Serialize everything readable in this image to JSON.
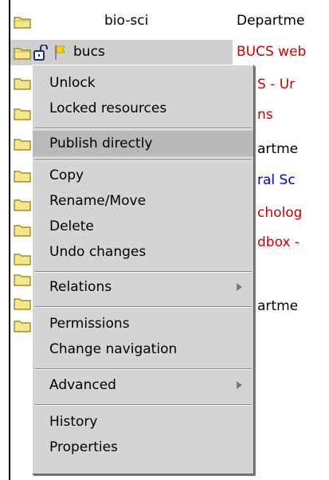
{
  "rows": [
    {
      "name": "bio-sci",
      "desc": "Departme"
    },
    {
      "name": "bucs",
      "desc": "BUCS web"
    }
  ],
  "fragments": {
    "f3": "S - Ur",
    "f4": "ns",
    "f5": "artme",
    "f6": "ral Sc",
    "f7": "cholog",
    "f8": "dbox -",
    "f10": "artme"
  },
  "menu": {
    "unlock": "Unlock",
    "locked_resources": "Locked resources",
    "publish_directly": "Publish directly",
    "copy": "Copy",
    "rename_move": "Rename/Move",
    "delete": "Delete",
    "undo_changes": "Undo changes",
    "relations": "Relations",
    "permissions": "Permissions",
    "change_navigation": "Change navigation",
    "advanced": "Advanced",
    "history": "History",
    "properties": "Properties"
  },
  "colors": {
    "folder": "#f6e58a",
    "menu_bg": "#d4d4d4",
    "highlight": "#b9b9b9",
    "link_red": "#cc0000",
    "link_blue": "#0000cc"
  },
  "icons": {
    "folder": "folder-icon",
    "lock": "unlocked-padlock-icon",
    "flag": "yellow-flag-icon",
    "submenu": "submenu-arrow-icon"
  }
}
